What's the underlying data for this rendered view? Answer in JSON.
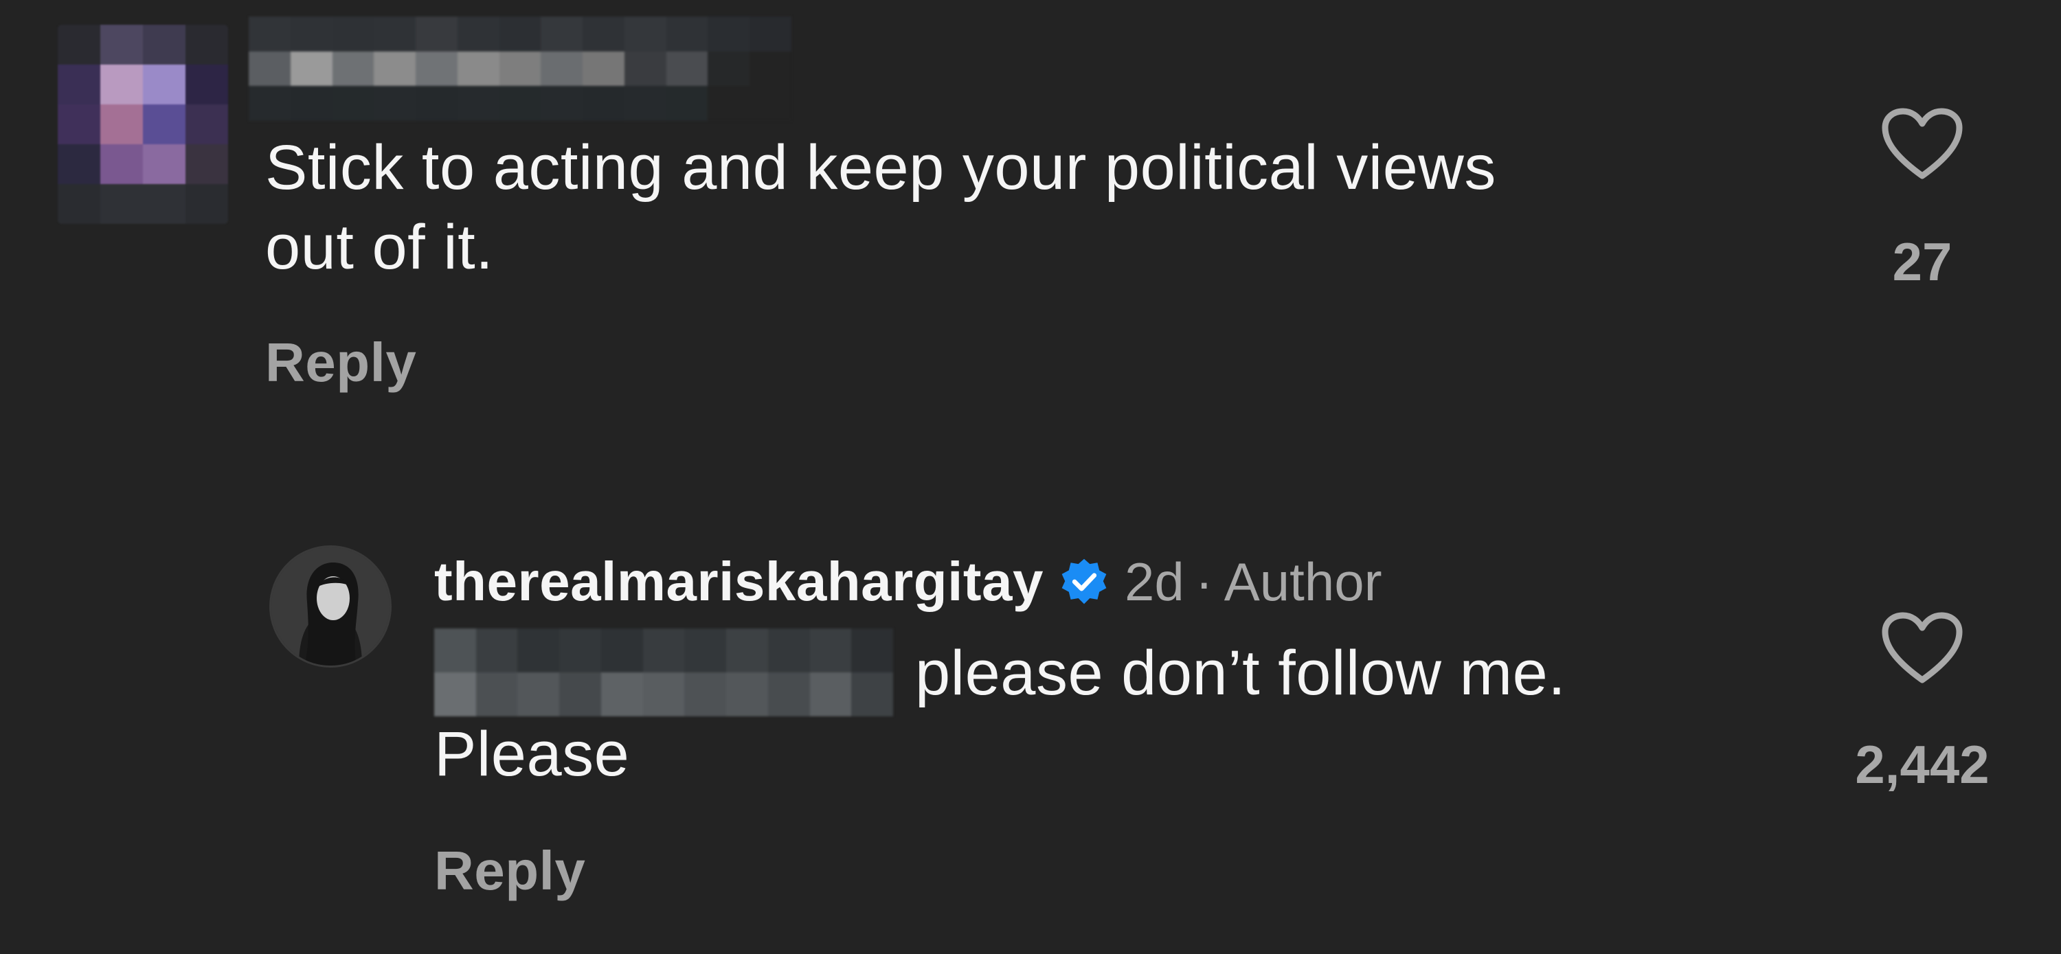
{
  "comment": {
    "text_line1": "Stick to acting and keep your political views",
    "text_line2": "out of it.",
    "reply_label": "Reply",
    "like_count": "27",
    "heart_icon": "heart-outline-icon"
  },
  "reply": {
    "username": "therealmariskahargitay",
    "verified_icon": "verified-badge-icon",
    "age": "2d",
    "separator": "·",
    "role": "Author",
    "text_line1": "please don’t follow me.",
    "text_line2": "Please",
    "reply_label": "Reply",
    "like_count": "2,442",
    "heart_icon": "heart-outline-icon"
  },
  "colors": {
    "background": "#232323",
    "text_primary": "#f5f5f5",
    "text_secondary": "#a8a8a8",
    "verified_blue": "#1a8cf5"
  }
}
